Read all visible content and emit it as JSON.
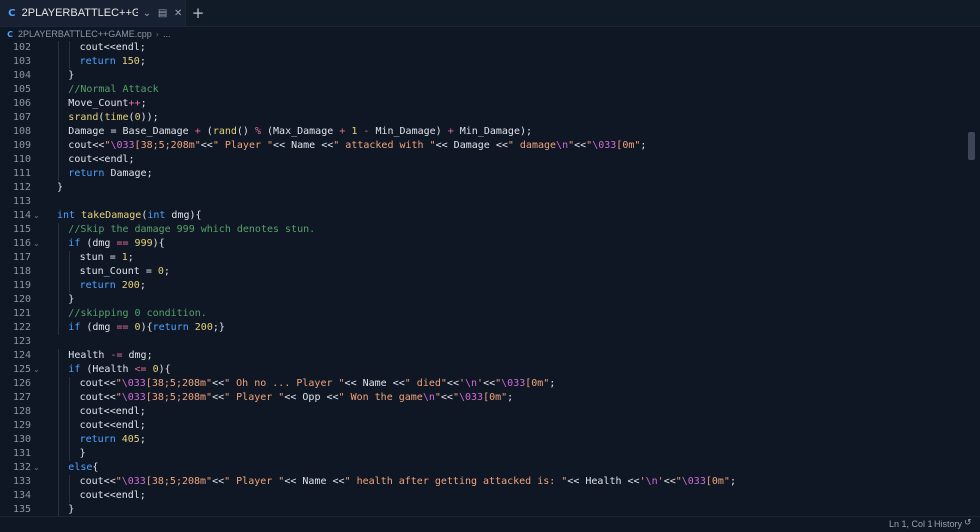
{
  "tab": {
    "icon": "cpp-file-icon",
    "title": "2PLAYERBATTLEC++GAM...",
    "add_label": "+"
  },
  "breadcrumb": {
    "file": "2PLAYERBATTLEC++GAME.cpp",
    "more": "..."
  },
  "editor": {
    "lines": [
      {
        "num": "102",
        "indent": 2,
        "tokens": [
          [
            "p",
            "cout<<endl;"
          ]
        ]
      },
      {
        "num": "103",
        "indent": 2,
        "tokens": [
          [
            "k",
            "return"
          ],
          [
            "p",
            " "
          ],
          [
            "n",
            "150"
          ],
          [
            "p",
            ";"
          ]
        ]
      },
      {
        "num": "104",
        "indent": 1,
        "tokens": [
          [
            "p",
            "}"
          ]
        ]
      },
      {
        "num": "105",
        "indent": 1,
        "tokens": [
          [
            "c",
            "//Normal Attack"
          ]
        ]
      },
      {
        "num": "106",
        "indent": 1,
        "tokens": [
          [
            "p",
            "Move_Count"
          ],
          [
            "o",
            "++"
          ],
          [
            "p",
            ";"
          ]
        ]
      },
      {
        "num": "107",
        "indent": 1,
        "tokens": [
          [
            "f",
            "srand"
          ],
          [
            "p",
            "("
          ],
          [
            "f",
            "time"
          ],
          [
            "p",
            "("
          ],
          [
            "n",
            "0"
          ],
          [
            "p",
            "));"
          ]
        ]
      },
      {
        "num": "108",
        "indent": 1,
        "tokens": [
          [
            "p",
            "Damage = Base_Damage "
          ],
          [
            "o",
            "+"
          ],
          [
            "p",
            " ("
          ],
          [
            "f",
            "rand"
          ],
          [
            "p",
            "() "
          ],
          [
            "o",
            "%"
          ],
          [
            "p",
            " (Max_Damage "
          ],
          [
            "o",
            "+"
          ],
          [
            "p",
            " "
          ],
          [
            "n",
            "1"
          ],
          [
            "p",
            " "
          ],
          [
            "o",
            "-"
          ],
          [
            "p",
            " Min_Damage) "
          ],
          [
            "o",
            "+"
          ],
          [
            "p",
            " Min_Damage);"
          ]
        ]
      },
      {
        "num": "109",
        "indent": 1,
        "tokens": [
          [
            "p",
            "cout<<"
          ],
          [
            "s",
            "\""
          ],
          [
            "e",
            "\\033"
          ],
          [
            "s",
            "[38;5;208m\""
          ],
          [
            "p",
            "<<"
          ],
          [
            "s",
            "\" Player \""
          ],
          [
            "p",
            "<< Name <<"
          ],
          [
            "s",
            "\" attacked with \""
          ],
          [
            "p",
            "<< Damage <<"
          ],
          [
            "s",
            "\" damage"
          ],
          [
            "e",
            "\\n"
          ],
          [
            "s",
            "\""
          ],
          [
            "p",
            "<<"
          ],
          [
            "s",
            "\""
          ],
          [
            "e",
            "\\033"
          ],
          [
            "s",
            "[0m\""
          ],
          [
            "p",
            ";"
          ]
        ]
      },
      {
        "num": "110",
        "indent": 1,
        "tokens": [
          [
            "p",
            "cout<<endl;"
          ]
        ]
      },
      {
        "num": "111",
        "indent": 1,
        "tokens": [
          [
            "k",
            "return"
          ],
          [
            "p",
            " Damage;"
          ]
        ]
      },
      {
        "num": "112",
        "indent": 0,
        "tokens": [
          [
            "p",
            "}"
          ]
        ]
      },
      {
        "num": "113",
        "indent": 0,
        "tokens": []
      },
      {
        "num": "114",
        "indent": 0,
        "fold": true,
        "tokens": [
          [
            "t",
            "int"
          ],
          [
            "p",
            " "
          ],
          [
            "f",
            "takeDamage"
          ],
          [
            "p",
            "("
          ],
          [
            "t",
            "int"
          ],
          [
            "p",
            " dmg){"
          ]
        ]
      },
      {
        "num": "115",
        "indent": 1,
        "tokens": [
          [
            "c",
            "//Skip the damage 999 which denotes stun."
          ]
        ]
      },
      {
        "num": "116",
        "indent": 1,
        "fold": true,
        "tokens": [
          [
            "k",
            "if"
          ],
          [
            "p",
            " (dmg "
          ],
          [
            "o",
            "=="
          ],
          [
            "p",
            " "
          ],
          [
            "n",
            "999"
          ],
          [
            "p",
            "){"
          ]
        ]
      },
      {
        "num": "117",
        "indent": 2,
        "tokens": [
          [
            "p",
            "stun = "
          ],
          [
            "n",
            "1"
          ],
          [
            "p",
            ";"
          ]
        ]
      },
      {
        "num": "118",
        "indent": 2,
        "tokens": [
          [
            "p",
            "stun_Count = "
          ],
          [
            "n",
            "0"
          ],
          [
            "p",
            ";"
          ]
        ]
      },
      {
        "num": "119",
        "indent": 2,
        "tokens": [
          [
            "k",
            "return"
          ],
          [
            "p",
            " "
          ],
          [
            "n",
            "200"
          ],
          [
            "p",
            ";"
          ]
        ]
      },
      {
        "num": "120",
        "indent": 1,
        "tokens": [
          [
            "p",
            "}"
          ]
        ]
      },
      {
        "num": "121",
        "indent": 1,
        "tokens": [
          [
            "c",
            "//skipping 0 condition."
          ]
        ]
      },
      {
        "num": "122",
        "indent": 1,
        "tokens": [
          [
            "k",
            "if"
          ],
          [
            "p",
            " (dmg "
          ],
          [
            "o",
            "=="
          ],
          [
            "p",
            " "
          ],
          [
            "n",
            "0"
          ],
          [
            "p",
            "){"
          ],
          [
            "k",
            "return"
          ],
          [
            "p",
            " "
          ],
          [
            "n",
            "200"
          ],
          [
            "p",
            ";}"
          ]
        ]
      },
      {
        "num": "123",
        "indent": 0,
        "tokens": []
      },
      {
        "num": "124",
        "indent": 1,
        "tokens": [
          [
            "p",
            "Health "
          ],
          [
            "o",
            "-="
          ],
          [
            "p",
            " dmg;"
          ]
        ]
      },
      {
        "num": "125",
        "indent": 1,
        "fold": true,
        "tokens": [
          [
            "k",
            "if"
          ],
          [
            "p",
            " (Health "
          ],
          [
            "o",
            "<="
          ],
          [
            "p",
            " "
          ],
          [
            "n",
            "0"
          ],
          [
            "p",
            "){"
          ]
        ]
      },
      {
        "num": "126",
        "indent": 2,
        "tokens": [
          [
            "p",
            "cout<<"
          ],
          [
            "s",
            "\""
          ],
          [
            "e",
            "\\033"
          ],
          [
            "s",
            "[38;5;208m\""
          ],
          [
            "p",
            "<<"
          ],
          [
            "s",
            "\" Oh no ... Player \""
          ],
          [
            "p",
            "<< Name <<"
          ],
          [
            "s",
            "\" died\""
          ],
          [
            "p",
            "<<"
          ],
          [
            "s",
            "'"
          ],
          [
            "e",
            "\\n"
          ],
          [
            "s",
            "'"
          ],
          [
            "p",
            "<<"
          ],
          [
            "s",
            "\""
          ],
          [
            "e",
            "\\033"
          ],
          [
            "s",
            "[0m\""
          ],
          [
            "p",
            ";"
          ]
        ]
      },
      {
        "num": "127",
        "indent": 2,
        "tokens": [
          [
            "p",
            "cout<<"
          ],
          [
            "s",
            "\""
          ],
          [
            "e",
            "\\033"
          ],
          [
            "s",
            "[38;5;208m\""
          ],
          [
            "p",
            "<<"
          ],
          [
            "s",
            "\" Player \""
          ],
          [
            "p",
            "<< Opp <<"
          ],
          [
            "s",
            "\" Won the game"
          ],
          [
            "e",
            "\\n"
          ],
          [
            "s",
            "\""
          ],
          [
            "p",
            "<<"
          ],
          [
            "s",
            "\""
          ],
          [
            "e",
            "\\033"
          ],
          [
            "s",
            "[0m\""
          ],
          [
            "p",
            ";"
          ]
        ]
      },
      {
        "num": "128",
        "indent": 2,
        "tokens": [
          [
            "p",
            "cout<<endl;"
          ]
        ]
      },
      {
        "num": "129",
        "indent": 2,
        "tokens": [
          [
            "p",
            "cout<<endl;"
          ]
        ]
      },
      {
        "num": "130",
        "indent": 2,
        "tokens": [
          [
            "k",
            "return"
          ],
          [
            "p",
            " "
          ],
          [
            "n",
            "405"
          ],
          [
            "p",
            ";"
          ]
        ]
      },
      {
        "num": "131",
        "indent": 2,
        "tokens": [
          [
            "p",
            "}"
          ]
        ]
      },
      {
        "num": "132",
        "indent": 1,
        "fold": true,
        "tokens": [
          [
            "k",
            "else"
          ],
          [
            "p",
            "{"
          ]
        ]
      },
      {
        "num": "133",
        "indent": 2,
        "tokens": [
          [
            "p",
            "cout<<"
          ],
          [
            "s",
            "\""
          ],
          [
            "e",
            "\\033"
          ],
          [
            "s",
            "[38;5;208m\""
          ],
          [
            "p",
            "<<"
          ],
          [
            "s",
            "\" Player \""
          ],
          [
            "p",
            "<< Name <<"
          ],
          [
            "s",
            "\" health after getting attacked is: \""
          ],
          [
            "p",
            "<< Health <<"
          ],
          [
            "s",
            "'"
          ],
          [
            "e",
            "\\n"
          ],
          [
            "s",
            "'"
          ],
          [
            "p",
            "<<"
          ],
          [
            "s",
            "\""
          ],
          [
            "e",
            "\\033"
          ],
          [
            "s",
            "[0m\""
          ],
          [
            "p",
            ";"
          ]
        ]
      },
      {
        "num": "134",
        "indent": 2,
        "tokens": [
          [
            "p",
            "cout<<endl;"
          ]
        ]
      },
      {
        "num": "135",
        "indent": 1,
        "tokens": [
          [
            "p",
            "}"
          ]
        ]
      }
    ]
  },
  "status": {
    "position": "Ln 1, Col 1",
    "history": "History"
  }
}
